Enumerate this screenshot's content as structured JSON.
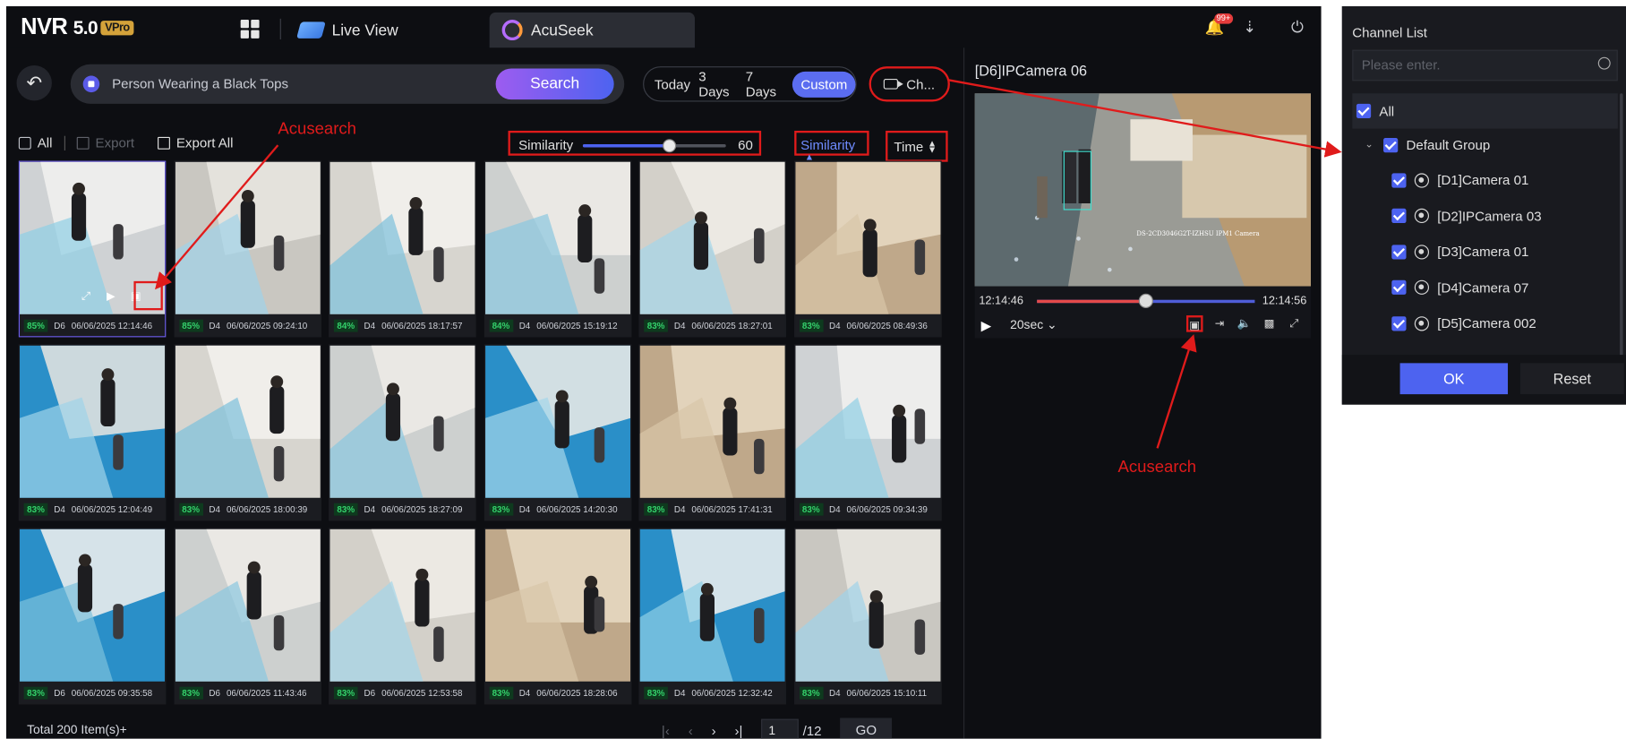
{
  "app": {
    "logo": "NVR",
    "version": "5.0",
    "edition": "VPro",
    "tabs": [
      {
        "label": "Live View"
      },
      {
        "label": "AcuSeek"
      }
    ],
    "notification_badge": "99+"
  },
  "search": {
    "query": "Person Wearing a Black Tops",
    "button": "Search",
    "ranges": [
      "Today",
      "3 Days",
      "7 Days",
      "Custom"
    ],
    "active_range": "Custom",
    "channel_button": "Ch..."
  },
  "toolbar": {
    "all_label": "All",
    "export_label": "Export",
    "export_all_label": "Export All",
    "similarity_label": "Similarity",
    "similarity_value": "60",
    "similarity_fraction": 0.6,
    "sort_similarity": "Similarity",
    "sort_time": "Time"
  },
  "results": [
    {
      "pct": "85%",
      "ch": "D6",
      "time": "06/06/2025 12:14:46",
      "selected": true
    },
    {
      "pct": "85%",
      "ch": "D4",
      "time": "06/06/2025 09:24:10"
    },
    {
      "pct": "84%",
      "ch": "D4",
      "time": "06/06/2025 18:17:57"
    },
    {
      "pct": "84%",
      "ch": "D4",
      "time": "06/06/2025 15:19:12"
    },
    {
      "pct": "83%",
      "ch": "D4",
      "time": "06/06/2025 18:27:01"
    },
    {
      "pct": "83%",
      "ch": "D4",
      "time": "06/06/2025 08:49:36"
    },
    {
      "pct": "83%",
      "ch": "D4",
      "time": "06/06/2025 12:04:49"
    },
    {
      "pct": "83%",
      "ch": "D4",
      "time": "06/06/2025 18:00:39"
    },
    {
      "pct": "83%",
      "ch": "D4",
      "time": "06/06/2025 18:27:09"
    },
    {
      "pct": "83%",
      "ch": "D4",
      "time": "06/06/2025 14:20:30"
    },
    {
      "pct": "83%",
      "ch": "D4",
      "time": "06/06/2025 17:41:31"
    },
    {
      "pct": "83%",
      "ch": "D4",
      "time": "06/06/2025 09:34:39"
    },
    {
      "pct": "83%",
      "ch": "D6",
      "time": "06/06/2025 09:35:58"
    },
    {
      "pct": "83%",
      "ch": "D6",
      "time": "06/06/2025 11:43:46"
    },
    {
      "pct": "83%",
      "ch": "D6",
      "time": "06/06/2025 12:53:58"
    },
    {
      "pct": "83%",
      "ch": "D4",
      "time": "06/06/2025 18:28:06"
    },
    {
      "pct": "83%",
      "ch": "D4",
      "time": "06/06/2025 12:32:42"
    },
    {
      "pct": "83%",
      "ch": "D4",
      "time": "06/06/2025 15:10:11"
    }
  ],
  "footer": {
    "total": "Total 200 Item(s)+",
    "page": "1",
    "pages": "/12",
    "go": "GO"
  },
  "preview": {
    "title": "[D6]IPCamera 06",
    "start_time": "12:14:46",
    "end_time": "12:14:56",
    "progress_fraction": 0.5,
    "speed": "20sec",
    "overlay_text": "DS-2CD3046G2T-IZHSU IPM1 Camera"
  },
  "annotations": {
    "left": "Acusearch",
    "right": "Acusearch"
  },
  "channel_list": {
    "title": "Channel List",
    "placeholder": "Please enter.",
    "all_label": "All",
    "group_label": "Default Group",
    "channels": [
      "[D1]Camera 01",
      "[D2]IPCamera 03",
      "[D3]Camera 01",
      "[D4]Camera 07",
      "[D5]Camera 002"
    ],
    "ok": "OK",
    "reset": "Reset"
  },
  "colors": {
    "accent": "#4d63f0",
    "annotation_red": "#e01b1b",
    "similarity_green": "#34d16b"
  }
}
